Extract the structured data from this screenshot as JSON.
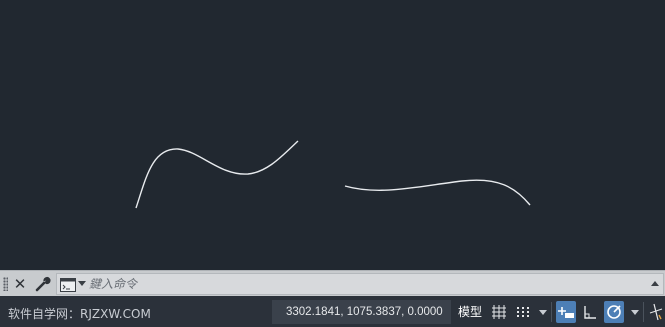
{
  "command_line": {
    "placeholder": "鍵入命令"
  },
  "status_bar": {
    "watermark": "软件自学网：RJZXW.COM",
    "coordinates": "3302.1841, 1075.3837, 0.0000",
    "model_tab": "模型",
    "icons": [
      "grid-icon",
      "snap-icon",
      "infer-constraints-icon",
      "ortho-icon",
      "polar-tracking-icon",
      "isodraft-icon"
    ]
  },
  "colors": {
    "canvas_background": "#212830",
    "spline_stroke": "#e8ebee",
    "active_toggle": "#4d7fb6"
  }
}
